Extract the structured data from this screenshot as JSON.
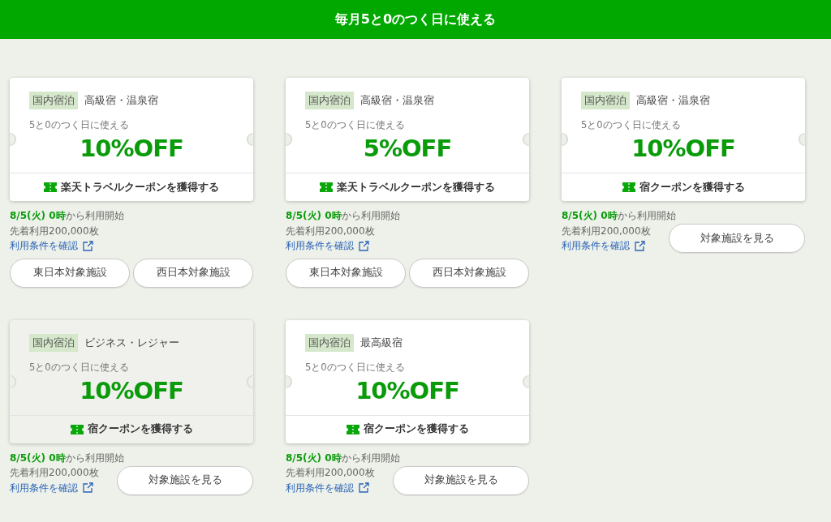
{
  "header": {
    "title": "毎月5と0のつく日に使える"
  },
  "coupons": [
    {
      "tag": "国内宿泊",
      "category": "高級宿・温泉宿",
      "condition": "5と0のつく日に使える",
      "discount": "10%OFF",
      "action": "楽天トラベルクーポンを獲得する",
      "hovered": false,
      "start": "**8/5(火) 0時**から利用開始",
      "limit": "先着利用200,000枚",
      "terms": "利用条件を確認",
      "buttons": [
        "東日本対象施設",
        "西日本対象施設"
      ]
    },
    {
      "tag": "国内宿泊",
      "category": "高級宿・温泉宿",
      "condition": "5と0のつく日に使える",
      "discount": "5%OFF",
      "action": "楽天トラベルクーポンを獲得する",
      "hovered": false,
      "start": "**8/5(火) 0時**から利用開始",
      "limit": "先着利用200,000枚",
      "terms": "利用条件を確認",
      "buttons": [
        "東日本対象施設",
        "西日本対象施設"
      ]
    },
    {
      "tag": "国内宿泊",
      "category": "高級宿・温泉宿",
      "condition": "5と0のつく日に使える",
      "discount": "10%OFF",
      "action": "宿クーポンを獲得する",
      "hovered": false,
      "start": "**8/5(火) 0時**から利用開始",
      "limit": "先着利用200,000枚",
      "terms": "利用条件を確認",
      "buttons": [
        "対象施設を見る"
      ]
    },
    {
      "tag": "国内宿泊",
      "category": "ビジネス・レジャー",
      "condition": "5と0のつく日に使える",
      "discount": "10%OFF",
      "action": "宿クーポンを獲得する",
      "hovered": true,
      "start": "**8/5(火) 0時**から利用開始",
      "limit": "先着利用200,000枚",
      "terms": "利用条件を確認",
      "buttons": [
        "対象施設を見る"
      ]
    },
    {
      "tag": "国内宿泊",
      "category": "最高級宿",
      "condition": "5と0のつく日に使える",
      "discount": "10%OFF",
      "action": "宿クーポンを獲得する",
      "hovered": false,
      "start": "**8/5(火) 0時**から利用開始",
      "limit": "先着利用200,000枚",
      "terms": "利用条件を確認",
      "buttons": [
        "対象施設を見る"
      ]
    }
  ]
}
